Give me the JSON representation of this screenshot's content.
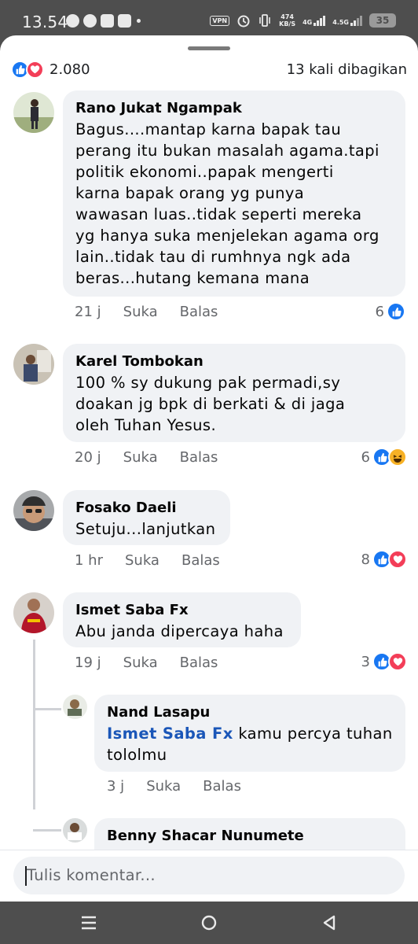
{
  "status_bar": {
    "time": "13.54",
    "vpn": "VPN",
    "net_speed_top": "474",
    "net_speed_unit": "KB/S",
    "net_type_1": "4G",
    "net_type_2": "4.5G",
    "battery": "35"
  },
  "reactions_summary": {
    "count": "2.080",
    "shares": "13 kali dibagikan"
  },
  "comments": [
    {
      "author": "Rano Jukat Ngampak",
      "lines": [
        "Bagus....mantap karna bapak tau",
        "perang itu bukan masalah agama.tapi",
        "politik ekonomi..papak mengerti",
        "karna bapak orang yg punya",
        "wawasan luas..tidak seperti mereka",
        "yg hanya suka menjelekan agama org",
        "lain..tidak tau di rumhnya ngk ada",
        "beras...hutang kemana mana"
      ],
      "time": "21 j",
      "like_label": "Suka",
      "reply_label": "Balas",
      "reaction_count": "6"
    },
    {
      "author": "Karel Tombokan",
      "lines": [
        "100 % sy dukung pak permadi,sy",
        "doakan jg bpk di berkati & di jaga",
        "oleh Tuhan Yesus."
      ],
      "time": "20 j",
      "like_label": "Suka",
      "reply_label": "Balas",
      "reaction_count": "6"
    },
    {
      "author": "Fosako Daeli",
      "lines": [
        "Setuju...lanjutkan"
      ],
      "time": "1 hr",
      "like_label": "Suka",
      "reply_label": "Balas",
      "reaction_count": "8"
    },
    {
      "author": "Ismet Saba Fx",
      "lines": [
        "Abu janda dipercaya haha"
      ],
      "time": "19 j",
      "like_label": "Suka",
      "reply_label": "Balas",
      "reaction_count": "3"
    }
  ],
  "replies": [
    {
      "author": "Nand Lasapu",
      "mention": "Ismet Saba Fx",
      "line1_rest": " kamu percya tuhan",
      "line2": "tololmu",
      "time": "3 j",
      "like_label": "Suka",
      "reply_label": "Balas"
    },
    {
      "author": "Benny Shacar Nunumete"
    }
  ],
  "composer": {
    "placeholder": "Tulis komentar..."
  },
  "colors": {
    "like": "#1877f2",
    "love": "#f33e58",
    "haha": "#f7b125",
    "mention": "#1a56b8"
  }
}
